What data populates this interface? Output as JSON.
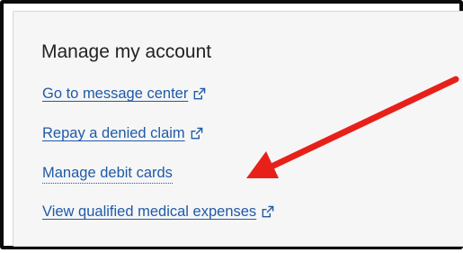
{
  "account_panel": {
    "heading": "Manage my account",
    "links": [
      {
        "label": "Go to message center",
        "icon": "external-link-icon",
        "external": true
      },
      {
        "label": "Repay a denied claim",
        "icon": "external-link-icon",
        "external": true
      },
      {
        "label": "Manage debit cards",
        "external": false
      },
      {
        "label": "View qualified medical expenses",
        "icon": "external-link-icon",
        "external": true
      }
    ]
  },
  "annotation": {
    "type": "arrow",
    "color": "#e8201a",
    "points_to": "Manage debit cards"
  },
  "colors": {
    "link": "#1f5aa8",
    "heading": "#222222",
    "card_background": "#f6f6f6",
    "frame_border": "#0a0a0a"
  }
}
